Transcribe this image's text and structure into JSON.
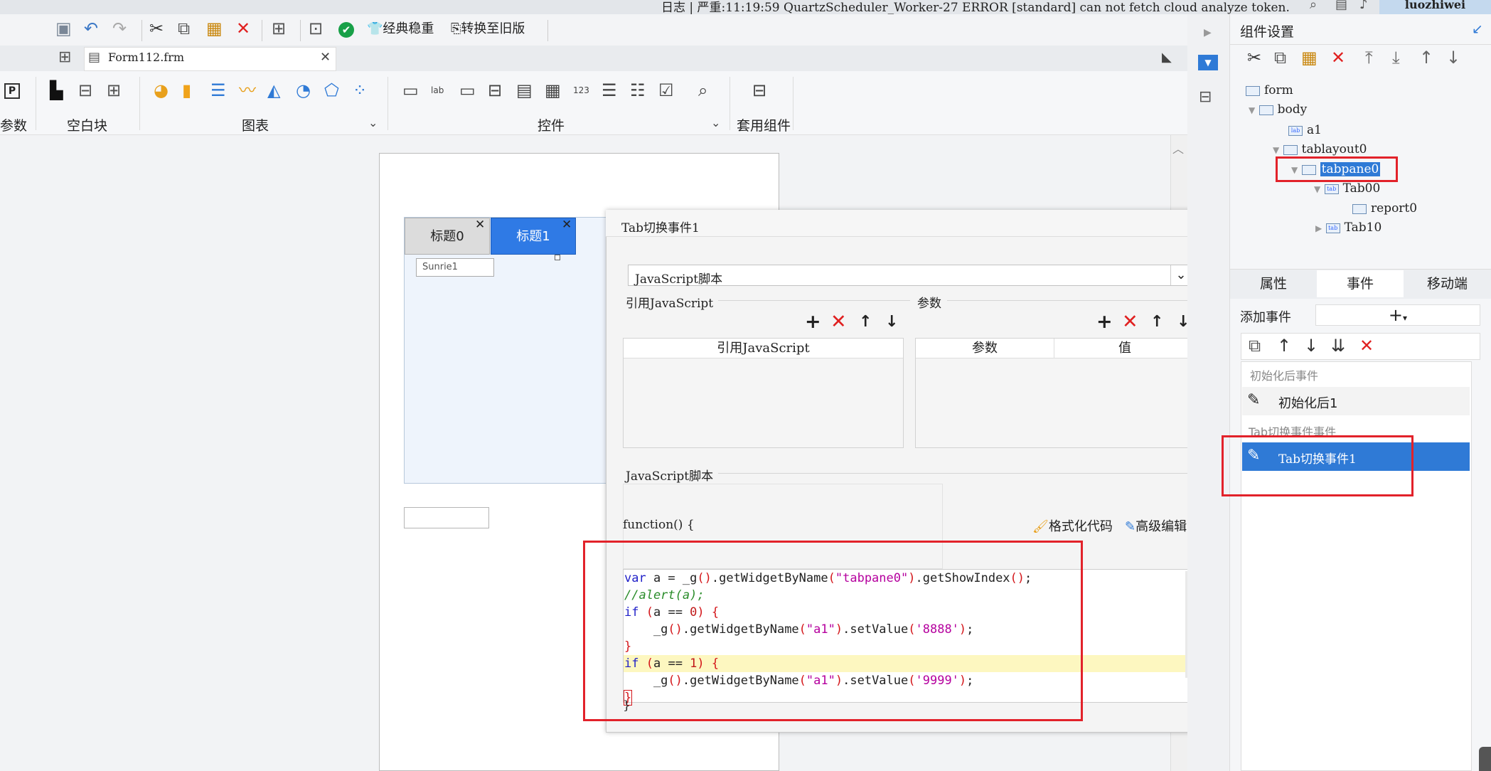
{
  "statusbar": {
    "message": "日志 | 严重:11:19:59 QuartzScheduler_Worker-27 ERROR [standard] can not fetch cloud analyze token.",
    "user": "luozhiwei"
  },
  "toolbar": {
    "classic_label": "经典稳重",
    "convert_label": "转换至旧版"
  },
  "file_tab": {
    "name": "Form112.frm"
  },
  "ribbon": {
    "param_label": "参数",
    "blank_block_label": "空白块",
    "chart_label": "图表",
    "controls_label": "控件",
    "template_label": "套用组件"
  },
  "canvas": {
    "tab0": "标题0",
    "tab1": "标题1",
    "chart_stub": "Sunrie1"
  },
  "dialog": {
    "title": "Tab切换事件1",
    "type_value": "JavaScript脚本",
    "ref_js_group": "引用JavaScript",
    "ref_js_header": "引用JavaScript",
    "params_group": "参数",
    "params_header": "参数",
    "value_header": "值",
    "script_group": "JavaScript脚本",
    "function_sig": "function() {",
    "format_btn": "格式化代码",
    "advanced_btn": "高级编辑",
    "code_closing": "}"
  },
  "right_panel": {
    "title": "组件设置",
    "tree": [
      "form",
      "body",
      "a1",
      "tablayout0",
      "tabpane0",
      "Tab00",
      "report0",
      "Tab10"
    ],
    "tabs": [
      "属性",
      "事件",
      "移动端"
    ],
    "add_event_label": "添加事件",
    "group_init": "初始化后事件",
    "event_init": "初始化后1",
    "group_tab": "Tab切换事件事件",
    "event_tab": "Tab切换事件1"
  }
}
